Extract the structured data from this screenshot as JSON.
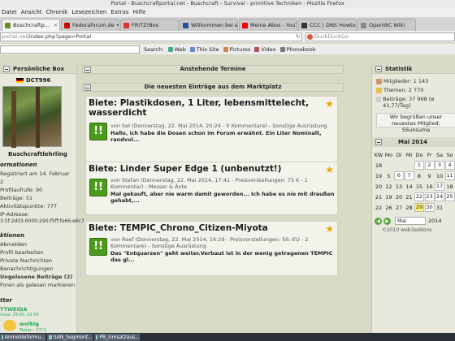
{
  "window": {
    "title": "Portal - Buschcraftportal.net - Buschcraft - Survival - primitive Techniken - Mozilla Firefox"
  },
  "menu": [
    "Datei",
    "Ansicht",
    "Chronik",
    "Lesezeichen",
    "Extras",
    "Hilfe"
  ],
  "tabs": [
    {
      "label": "Buschcraftp...",
      "active": true,
      "color": "#6b8e23"
    },
    {
      "label": "Fedoraforum.de •...",
      "active": false,
      "color": "#c00"
    },
    {
      "label": "FRITZ!Box",
      "active": false,
      "color": "#d33"
    },
    {
      "label": "Willkommen bei e...",
      "active": false,
      "color": "#2a4d9b"
    },
    {
      "label": "Meine Abos - YouT...",
      "active": false,
      "color": "#e00"
    },
    {
      "label": "CCC | DNS Howto",
      "active": false,
      "color": "#333"
    },
    {
      "label": "OpenWC Wiki",
      "active": false,
      "color": "#888"
    }
  ],
  "url": {
    "dim": "portal.net",
    "rest": "/index.php?page=Portal"
  },
  "search": {
    "placeholder": "DuckDuckGo"
  },
  "bookmarks": {
    "search_label": "Search:",
    "items": [
      "Web",
      "This Site",
      "Pictures",
      "Video",
      "Phonebook"
    ]
  },
  "left": {
    "box_title": "Persönliche Box",
    "username": "DCT996",
    "rank": "Buschcraftlehrling",
    "info_heading": "ormationen",
    "info_lines": [
      "Registriert am 14. Februar",
      "2",
      "Profilaufrufe: 90",
      "Beiträge: 51",
      "Aktivitätspunkte: 777",
      "IP-Adresse:",
      "3:5f:2d03:6000:290:f5ff:fe66:e6c7"
    ],
    "actions_heading": "ktionen",
    "actions": [
      "Abmelden",
      "Profil bearbeiten",
      "Private Nachrichten",
      "Benachrichtigungen",
      "Ungelesene Beiträge (2)",
      "Foren als gelesen markieren"
    ],
    "weather_heading": "tter",
    "weather_lines": [
      "TTWEIDA",
      "ctual: 29.05.-12:00"
    ],
    "weather_now": "wolkig",
    "weather_temp": "Temp.: 23°C"
  },
  "main": {
    "header1": "Anstehende Termine",
    "header2": "Die neuesten Einträge aus dem Marktplatz",
    "entries": [
      {
        "title": "Biete: Plastikdosen, 1 Liter, lebensmittelecht, wasserdicht",
        "meta": "von Sel (Donnerstag, 22. Mai 2014, 20:24 - 0 Kommentare) - Sonstige Ausrüstung",
        "text": "Hallo, ich habe die Dosen schon im Forum erwähnt. Ein Liter Nominalt, randvol..."
      },
      {
        "title": "Biete: Linder Super Edge 1 (unbenutzt!)",
        "meta": "von Stefan (Donnerstag, 22. Mai 2014, 17:41 - Preisvorstellungen: 75 € - 1 Kommentar) - Messer & Äxte",
        "text": "Mal gekauft, aber nie warm damit geworden... Ich habe es nie mit draußen gehabt,..."
      },
      {
        "title": "Biete: TEMPIC_Chrono_Citizen-Miyota",
        "meta": "von Reef (Donnerstag, 22. Mai 2014, 16:29 - Preisvorstellungen: 50,-EU - 2 Kommentare) - Sonstige Ausrüstung",
        "text": "Das \"Entquarzen\" geht weiter.Verbaut ist in der wenig getragenen TEMPIC das gl..."
      }
    ]
  },
  "right": {
    "title": "Statistik",
    "stats": [
      "Mitglieder: 1 143",
      "Themen: 2 770",
      "Beiträge: 37 968 (ø 41,77/Tag)"
    ],
    "welcome": "Wir begrüßen unser neuestes Mitglied: SSunsuma",
    "cal_title": "Mai 2014",
    "cal_head": [
      "KW",
      "Mo",
      "Di",
      "Mi",
      "Do",
      "Fr",
      "Sa",
      "So"
    ],
    "cal_rows": [
      [
        "18",
        "",
        "",
        "",
        "1",
        "2",
        "3",
        "4"
      ],
      [
        "19",
        "5",
        "6",
        "7",
        "8",
        "9",
        "10",
        "11"
      ],
      [
        "20",
        "12",
        "13",
        "14",
        "15",
        "16",
        "17",
        "18"
      ],
      [
        "21",
        "19",
        "20",
        "21",
        "22",
        "23",
        "24",
        "25"
      ],
      [
        "22",
        "26",
        "27",
        "28",
        "29",
        "30",
        "31",
        ""
      ]
    ],
    "month_select": "Mai",
    "year": "2014",
    "copyright": "©2010 web3addons"
  },
  "taskbar": [
    "Anmeldeformu...",
    "SAN_Segment...",
    "PB_Umsatzaus..."
  ]
}
